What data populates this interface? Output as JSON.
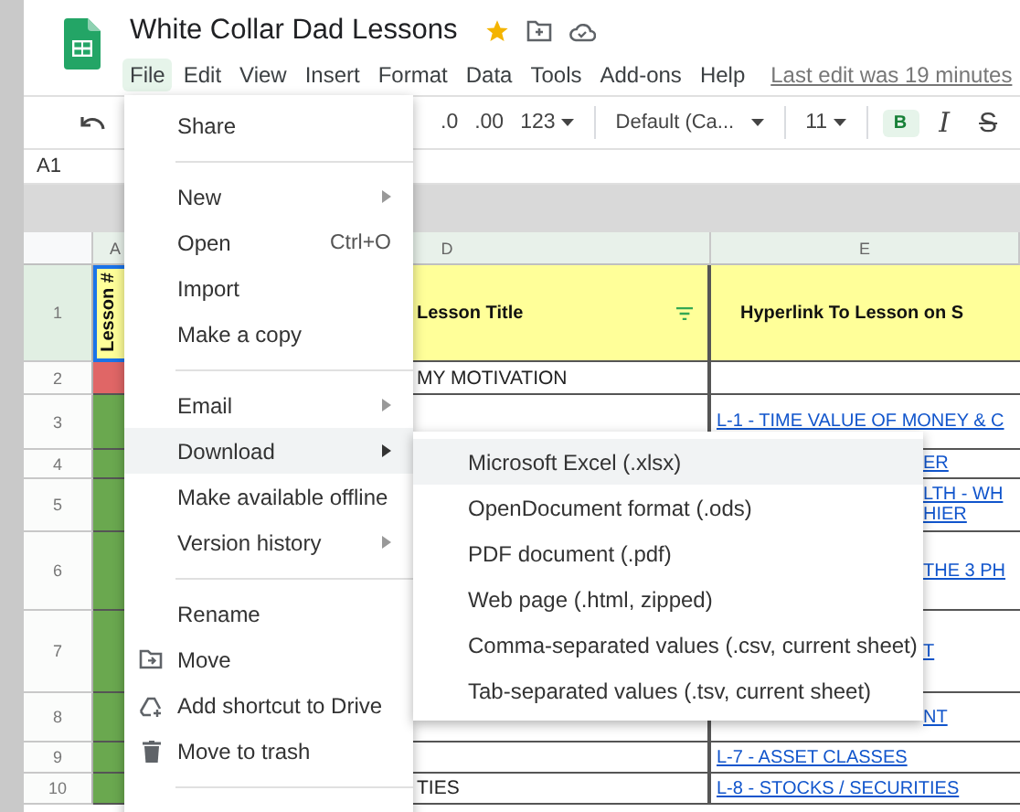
{
  "document": {
    "title": "White Collar Dad Lessons",
    "starred": true
  },
  "menu_bar": [
    {
      "label": "File",
      "selected": true
    },
    {
      "label": "Edit",
      "selected": false
    },
    {
      "label": "View",
      "selected": false
    },
    {
      "label": "Insert",
      "selected": false
    },
    {
      "label": "Format",
      "selected": false
    },
    {
      "label": "Data",
      "selected": false
    },
    {
      "label": "Tools",
      "selected": false
    },
    {
      "label": "Add-ons",
      "selected": false
    },
    {
      "label": "Help",
      "selected": false
    }
  ],
  "last_edit": "Last edit was 19 minutes",
  "toolbar": [
    {
      "kind": "button",
      "label": ".0"
    },
    {
      "kind": "button",
      "label": ".00"
    },
    {
      "kind": "dropdown",
      "label": "123"
    },
    {
      "kind": "divider"
    },
    {
      "kind": "dropdown",
      "label": "Default (Ca..."
    },
    {
      "kind": "divider"
    },
    {
      "kind": "dropdown",
      "label": "11"
    },
    {
      "kind": "divider"
    },
    {
      "kind": "bold",
      "label": "B",
      "selected": true
    },
    {
      "kind": "italic",
      "label": "I",
      "selected": false
    },
    {
      "kind": "strike",
      "label": "S",
      "selected": false
    }
  ],
  "name_box": "A1",
  "columns": [
    "A",
    "D",
    "E"
  ],
  "rows": [
    {
      "kind": "header",
      "number": "1",
      "selected": true,
      "color": "#ffff99",
      "lesson": "Lesson #",
      "title": "Lesson Title",
      "link_lines": [
        "Hyperlink To Lesson on S"
      ]
    },
    {
      "kind": "row",
      "number": "2",
      "selected": false,
      "color": "#e06666",
      "title": "MY MOTIVATION"
    },
    {
      "kind": "row",
      "number": "3",
      "selected": false,
      "color": "#6aa84f",
      "link_lines": [
        "L-1 - TIME VALUE OF MONEY & C"
      ]
    },
    {
      "kind": "covered",
      "number": "4",
      "selected": false,
      "color": "#6aa84f",
      "link_lines": [
        "ER"
      ]
    },
    {
      "kind": "covered",
      "number": "5",
      "selected": false,
      "color": "#6aa84f",
      "link_lines": [
        "LTH - WH",
        "HIER"
      ]
    },
    {
      "kind": "covered",
      "number": "6",
      "selected": false,
      "color": "#6aa84f",
      "link_lines": [
        "THE 3 PH"
      ]
    },
    {
      "kind": "covered",
      "number": "7",
      "selected": false,
      "color": "#6aa84f",
      "link_lines": [
        "T"
      ]
    },
    {
      "kind": "partly_covered",
      "number": "8",
      "selected": false,
      "color": "#6aa84f",
      "link_lines": [
        "NT"
      ]
    },
    {
      "kind": "row",
      "number": "9",
      "selected": false,
      "color": "#6aa84f",
      "link_lines": [
        "L-7 - ASSET CLASSES"
      ]
    },
    {
      "kind": "row",
      "number": "10",
      "selected": false,
      "color": "#6aa84f",
      "title": "TIES",
      "link_lines": [
        "L-8 - STOCKS / SECURITIES"
      ]
    }
  ],
  "file_menu": [
    {
      "kind": "item",
      "label": "Share"
    },
    {
      "kind": "divider"
    },
    {
      "kind": "submenu",
      "label": "New",
      "selected": false
    },
    {
      "kind": "item",
      "label": "Open",
      "shortcut": "Ctrl+O"
    },
    {
      "kind": "item",
      "label": "Import"
    },
    {
      "kind": "item",
      "label": "Make a copy"
    },
    {
      "kind": "divider"
    },
    {
      "kind": "submenu",
      "label": "Email",
      "selected": false
    },
    {
      "kind": "submenu",
      "label": "Download",
      "selected": true
    },
    {
      "kind": "item",
      "label": "Make available offline"
    },
    {
      "kind": "submenu",
      "label": "Version history",
      "selected": false
    },
    {
      "kind": "divider"
    },
    {
      "kind": "item",
      "label": "Rename"
    },
    {
      "kind": "move",
      "label": "Move"
    },
    {
      "kind": "shortcut",
      "label": "Add shortcut to Drive"
    },
    {
      "kind": "trash",
      "label": "Move to trash"
    },
    {
      "kind": "divider"
    }
  ],
  "download_menu": [
    {
      "label": "Microsoft Excel (.xlsx)",
      "selected": true
    },
    {
      "label": "OpenDocument format (.ods)",
      "selected": false
    },
    {
      "label": "PDF document (.pdf)",
      "selected": false
    },
    {
      "label": "Web page (.html, zipped)",
      "selected": false
    },
    {
      "label": "Comma-separated values (.csv, current sheet)",
      "selected": false
    },
    {
      "label": "Tab-separated values (.tsv, current sheet)",
      "selected": false
    }
  ]
}
